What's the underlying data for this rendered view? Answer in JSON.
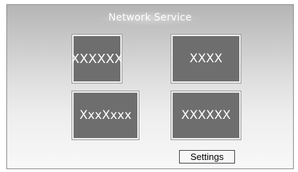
{
  "window": {
    "title": "Network Service"
  },
  "tiles": [
    {
      "label": "XXXXXX"
    },
    {
      "label": "XXXX"
    },
    {
      "label": "XxxXxxx"
    },
    {
      "label": "XXXXXX"
    }
  ],
  "footer": {
    "settings_label": "Settings"
  },
  "colors": {
    "tile_background": "#6e6e6e",
    "tile_border": "#f2f2f2",
    "title_text": "#ffffff"
  }
}
